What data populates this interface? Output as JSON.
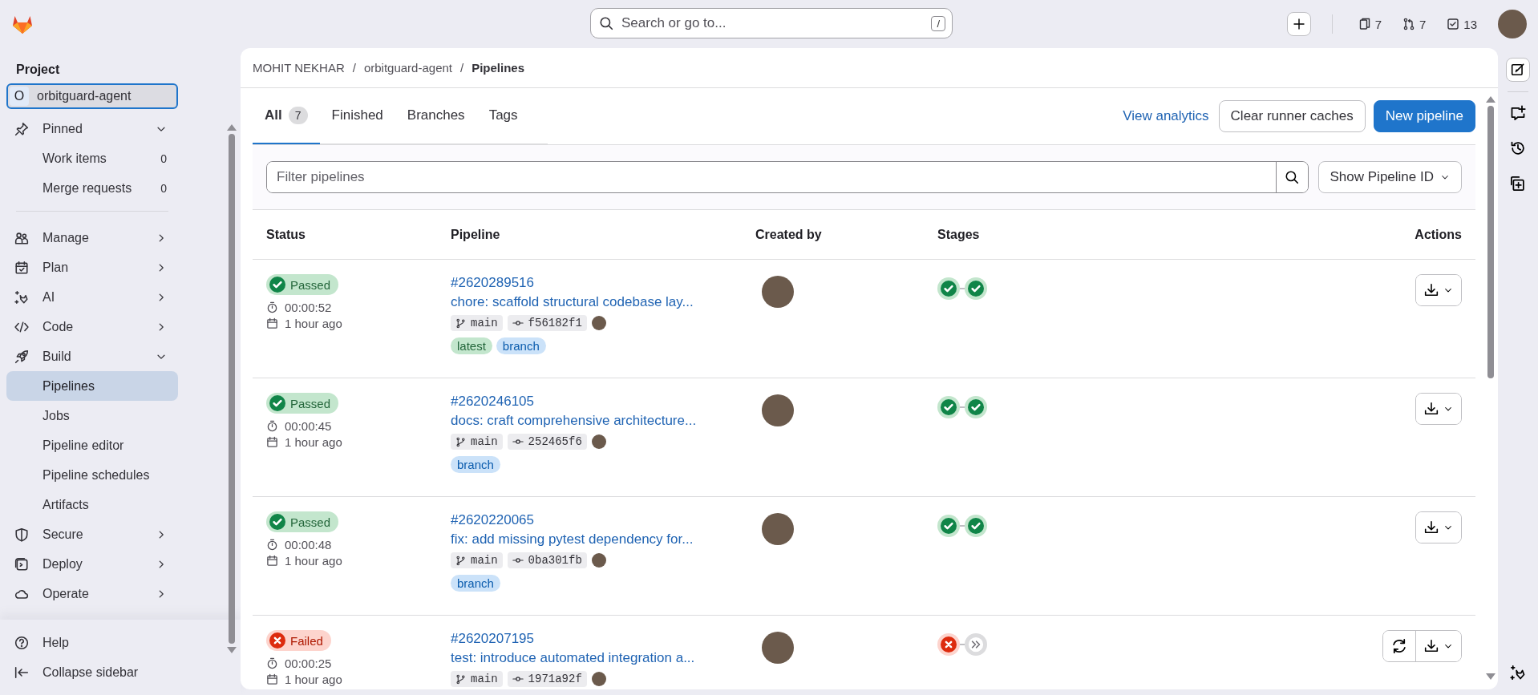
{
  "top_bar": {
    "search": {
      "placeholder": "Search or go to...",
      "shortcut": "/"
    },
    "counters": [
      "7",
      "7",
      "13"
    ]
  },
  "sidebar": {
    "heading": "Project",
    "project": {
      "initial": "O",
      "name": "orbitguard-agent"
    },
    "items": [
      {
        "label": "Pinned",
        "expanded": true,
        "children": [
          {
            "label": "Work items",
            "count": "0",
            "selected": false
          },
          {
            "label": "Merge requests",
            "count": "0",
            "selected": false
          }
        ]
      },
      {
        "label": "Manage",
        "expanded": false
      },
      {
        "label": "Plan",
        "expanded": false
      },
      {
        "label": "AI",
        "expanded": false
      },
      {
        "label": "Code",
        "expanded": false
      },
      {
        "label": "Build",
        "expanded": true,
        "children": [
          {
            "label": "Pipelines",
            "selected": true
          },
          {
            "label": "Jobs",
            "selected": false
          },
          {
            "label": "Pipeline editor",
            "selected": false
          },
          {
            "label": "Pipeline schedules",
            "selected": false
          },
          {
            "label": "Artifacts",
            "selected": false
          }
        ]
      },
      {
        "label": "Secure",
        "expanded": false
      },
      {
        "label": "Deploy",
        "expanded": false
      },
      {
        "label": "Operate",
        "expanded": false
      }
    ],
    "footer": [
      "Help",
      "Collapse sidebar"
    ]
  },
  "breadcrumb": {
    "items": [
      "MOHIT NEKHAR",
      "orbitguard-agent",
      "Pipelines"
    ],
    "separator": "/"
  },
  "tabs": [
    {
      "label": "All",
      "count": "7",
      "selected": true
    },
    {
      "label": "Finished",
      "selected": false
    },
    {
      "label": "Branches",
      "selected": false
    },
    {
      "label": "Tags",
      "selected": false
    }
  ],
  "header_actions": {
    "link": "View analytics",
    "secondary": "Clear runner caches",
    "primary": "New pipeline"
  },
  "filter": {
    "placeholder": "Filter pipelines",
    "display_dropdown": "Show Pipeline ID"
  },
  "table": {
    "columns": [
      "Status",
      "Pipeline",
      "Created by",
      "Stages",
      "Actions"
    ],
    "rows": [
      {
        "status": {
          "kind": "passed",
          "label": "Passed"
        },
        "duration": "00:00:52",
        "created": "1 hour ago",
        "id": "#2620289516",
        "title": "chore: scaffold structural codebase lay...",
        "branch": "main",
        "commit": "f56182f1",
        "tags": [
          {
            "kind": "latest",
            "label": "latest"
          },
          {
            "kind": "branch",
            "label": "branch"
          }
        ],
        "stages": [
          {
            "kind": "success"
          },
          {
            "kind": "success"
          }
        ],
        "retry": false
      },
      {
        "status": {
          "kind": "passed",
          "label": "Passed"
        },
        "duration": "00:00:45",
        "created": "1 hour ago",
        "id": "#2620246105",
        "title": "docs: craft comprehensive architecture...",
        "branch": "main",
        "commit": "252465f6",
        "tags": [
          {
            "kind": "branch",
            "label": "branch"
          }
        ],
        "stages": [
          {
            "kind": "success"
          },
          {
            "kind": "success"
          }
        ],
        "retry": false
      },
      {
        "status": {
          "kind": "passed",
          "label": "Passed"
        },
        "duration": "00:00:48",
        "created": "1 hour ago",
        "id": "#2620220065",
        "title": "fix: add missing pytest dependency for...",
        "branch": "main",
        "commit": "0ba301fb",
        "tags": [
          {
            "kind": "branch",
            "label": "branch"
          }
        ],
        "stages": [
          {
            "kind": "success"
          },
          {
            "kind": "success"
          }
        ],
        "retry": false
      },
      {
        "status": {
          "kind": "failed",
          "label": "Failed"
        },
        "duration": "00:00:25",
        "created": "1 hour ago",
        "id": "#2620207195",
        "title": "test: introduce automated integration a...",
        "branch": "main",
        "commit": "1971a92f",
        "tags": [],
        "stages": [
          {
            "kind": "failed"
          },
          {
            "kind": "skipped"
          }
        ],
        "retry": true
      }
    ]
  }
}
